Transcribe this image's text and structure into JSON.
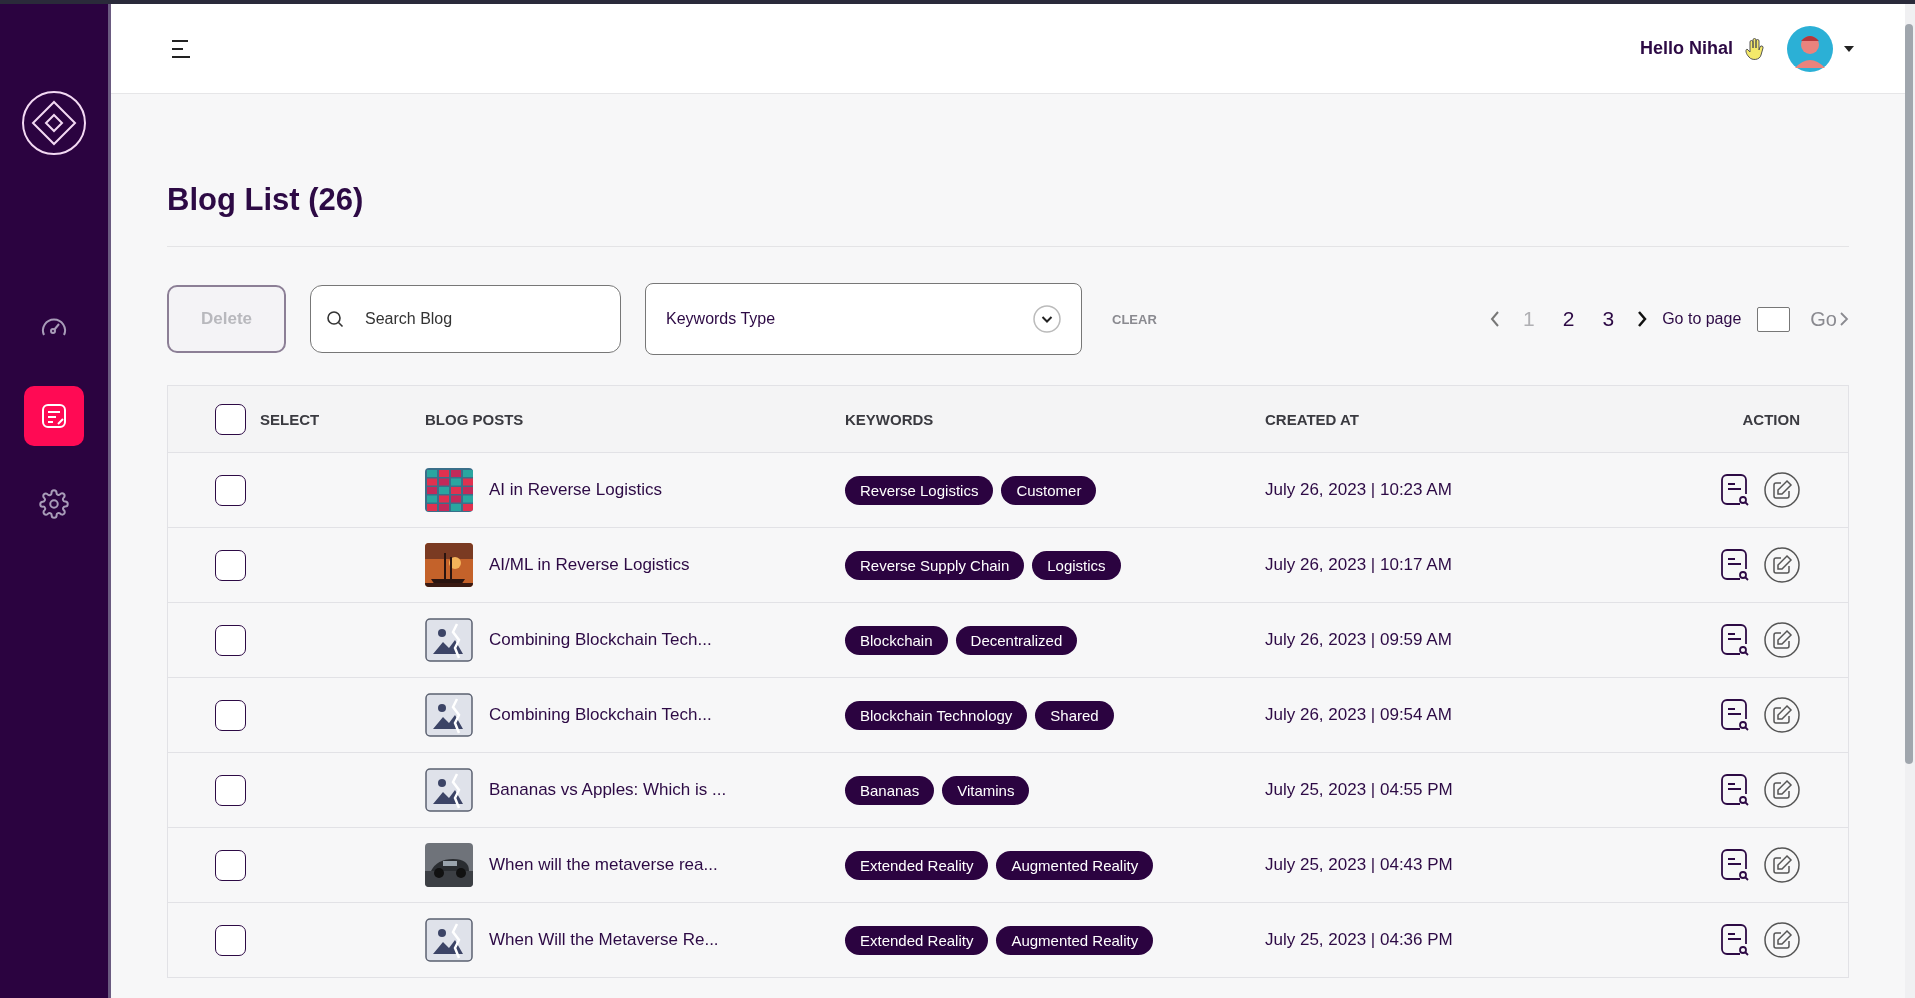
{
  "sidebar": {
    "items": [
      {
        "kind": "dashboard",
        "selected": false
      },
      {
        "kind": "blog",
        "selected": true
      },
      {
        "kind": "settings",
        "selected": false
      }
    ]
  },
  "header": {
    "greeting": "Hello Nihal"
  },
  "page_title": "Blog List (26)",
  "toolbar": {
    "delete_label": "Delete",
    "delete_disabled": true,
    "search": {
      "placeholder": "Search Blog"
    },
    "keywords_select": {
      "value": "Keywords Type"
    },
    "clear_label": "CLEAR"
  },
  "pagination": {
    "prev_disabled": true,
    "pages": [
      {
        "label": "1",
        "selected": true
      },
      {
        "label": "2",
        "selected": false
      },
      {
        "label": "3",
        "selected": false
      }
    ],
    "goto_label": "Go to page",
    "go_label": "Go"
  },
  "table": {
    "select_all": {
      "checked": false
    },
    "columns": [
      "SELECT",
      "BLOG POSTS",
      "KEYWORDS",
      "CREATED AT",
      "ACTION"
    ],
    "rows": [
      {
        "checked": false,
        "thumb": {
          "kind": "picture"
        },
        "title": "AI in Reverse Logistics",
        "keywords": [
          "Reverse Logistics",
          "Customer"
        ],
        "created_at": "July 26, 2023 | 10:23 AM"
      },
      {
        "checked": false,
        "thumb": {
          "kind": "picture"
        },
        "title": "AI/ML in Reverse Logistics",
        "keywords": [
          "Reverse Supply Chain",
          "Logistics"
        ],
        "created_at": "July 26, 2023 | 10:17 AM"
      },
      {
        "checked": false,
        "thumb": {
          "kind": "placeholder"
        },
        "title": "Combining Blockchain Tech...",
        "keywords": [
          "Blockchain",
          "Decentralized"
        ],
        "created_at": "July 26, 2023 | 09:59 AM"
      },
      {
        "checked": false,
        "thumb": {
          "kind": "placeholder"
        },
        "title": "Combining Blockchain Tech...",
        "keywords": [
          "Blockchain Technology",
          "Shared"
        ],
        "created_at": "July 26, 2023 | 09:54 AM"
      },
      {
        "checked": false,
        "thumb": {
          "kind": "placeholder"
        },
        "title": "Bananas vs Apples: Which is ...",
        "keywords": [
          "Bananas",
          "Vitamins"
        ],
        "created_at": "July 25, 2023 | 04:55 PM"
      },
      {
        "checked": false,
        "thumb": {
          "kind": "picture"
        },
        "title": "When will the metaverse rea...",
        "keywords": [
          "Extended Reality",
          "Augmented Reality"
        ],
        "created_at": "July 25, 2023 | 04:43 PM"
      },
      {
        "checked": false,
        "thumb": {
          "kind": "placeholder"
        },
        "title": "When Will the Metaverse Re...",
        "keywords": [
          "Extended Reality",
          "Augmented Reality"
        ],
        "created_at": "July 25, 2023 | 04:36 PM"
      }
    ]
  }
}
